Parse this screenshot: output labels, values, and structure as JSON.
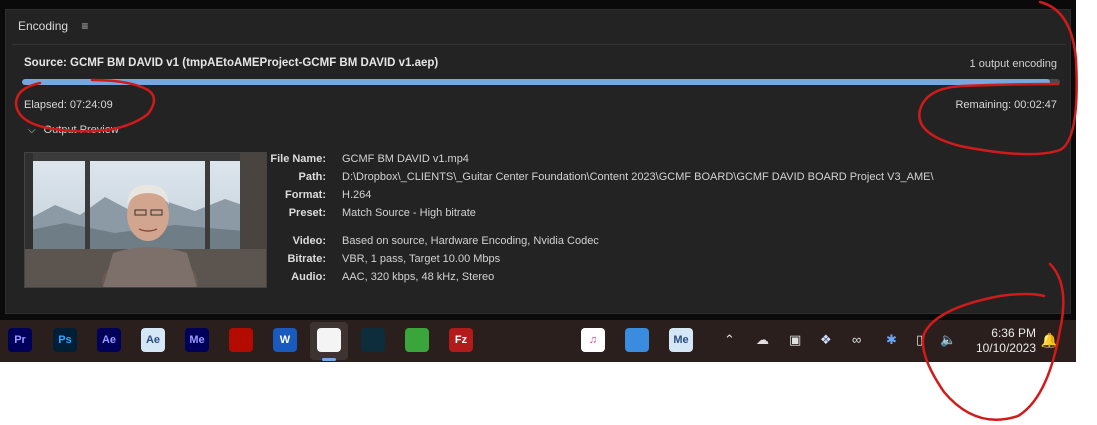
{
  "panel": {
    "tab_label": "Encoding",
    "menu_glyph": "≡"
  },
  "source": {
    "label": "Source: GCMF BM DAVID v1 (tmpAEtoAMEProject-GCMF BM DAVID v1.aep)",
    "outputs_text": "1 output encoding",
    "progress": 0.99,
    "elapsed": "Elapsed: 07:24:09",
    "remaining": "Remaining: 00:02:47"
  },
  "preview": {
    "toggle_label": "Output Preview"
  },
  "file_info": [
    {
      "label": "File Name:",
      "value": "GCMF BM DAVID v1.mp4"
    },
    {
      "label": "Path:",
      "value": "D:\\Dropbox\\_CLIENTS\\_Guitar Center Foundation\\Content 2023\\GCMF BOARD\\GCMF DAVID BOARD Project V3_AME\\"
    },
    {
      "label": "Format:",
      "value": "H.264"
    },
    {
      "label": "Preset:",
      "value": "Match Source - High bitrate"
    },
    {
      "label": "Video:",
      "value": "Based on source, Hardware Encoding, Nvidia Codec"
    },
    {
      "label": "Bitrate:",
      "value": "VBR, 1 pass, Target 10.00 Mbps"
    },
    {
      "label": "Audio:",
      "value": "AAC, 320 kbps, 48 kHz, Stereo"
    }
  ],
  "taskbar": {
    "apps": [
      {
        "name": "premiere-pro",
        "text": "Pr",
        "bg": "#00005b",
        "fg": "#9999ff"
      },
      {
        "name": "photoshop",
        "text": "Ps",
        "bg": "#001e36",
        "fg": "#31a8ff"
      },
      {
        "name": "after-effects",
        "text": "Ae",
        "bg": "#00005b",
        "fg": "#9999ff"
      },
      {
        "name": "after-effects-2",
        "text": "Ae",
        "bg": "#d5e6f7",
        "fg": "#2b4e80"
      },
      {
        "name": "media-encoder",
        "text": "Me",
        "bg": "#00005b",
        "fg": "#9999ff"
      },
      {
        "name": "acrobat",
        "text": "",
        "bg": "#b30b00",
        "fg": "#ffffff"
      },
      {
        "name": "word",
        "text": "W",
        "bg": "#185abd",
        "fg": "#ffffff"
      },
      {
        "name": "snipping-tool",
        "text": "",
        "bg": "#f4f4f4",
        "fg": "#333"
      },
      {
        "name": "screen-recorder",
        "text": "",
        "bg": "#0d2d3d",
        "fg": "#4fc3f7"
      },
      {
        "name": "green-app",
        "text": "",
        "bg": "#3aa53a",
        "fg": "#ffffff"
      },
      {
        "name": "filezilla",
        "text": "Fz",
        "bg": "#b31b1b",
        "fg": "#ffffff"
      },
      {
        "name": "fruit-app",
        "text": "",
        "bg": "#2a1f1d",
        "fg": "#ffb300"
      },
      {
        "name": "vlc",
        "text": "",
        "bg": "#2a1f1d",
        "fg": "#ff8800"
      },
      {
        "name": "itunes",
        "text": "♫",
        "bg": "#ffffff",
        "fg": "#e03c8a"
      },
      {
        "name": "icloud",
        "text": "",
        "bg": "#3a8dde",
        "fg": "#ffffff"
      },
      {
        "name": "media-encoder-2",
        "text": "Me",
        "bg": "#d5e6f7",
        "fg": "#2b4e80"
      }
    ],
    "time": "6:36 PM",
    "date": "10/10/2023"
  }
}
